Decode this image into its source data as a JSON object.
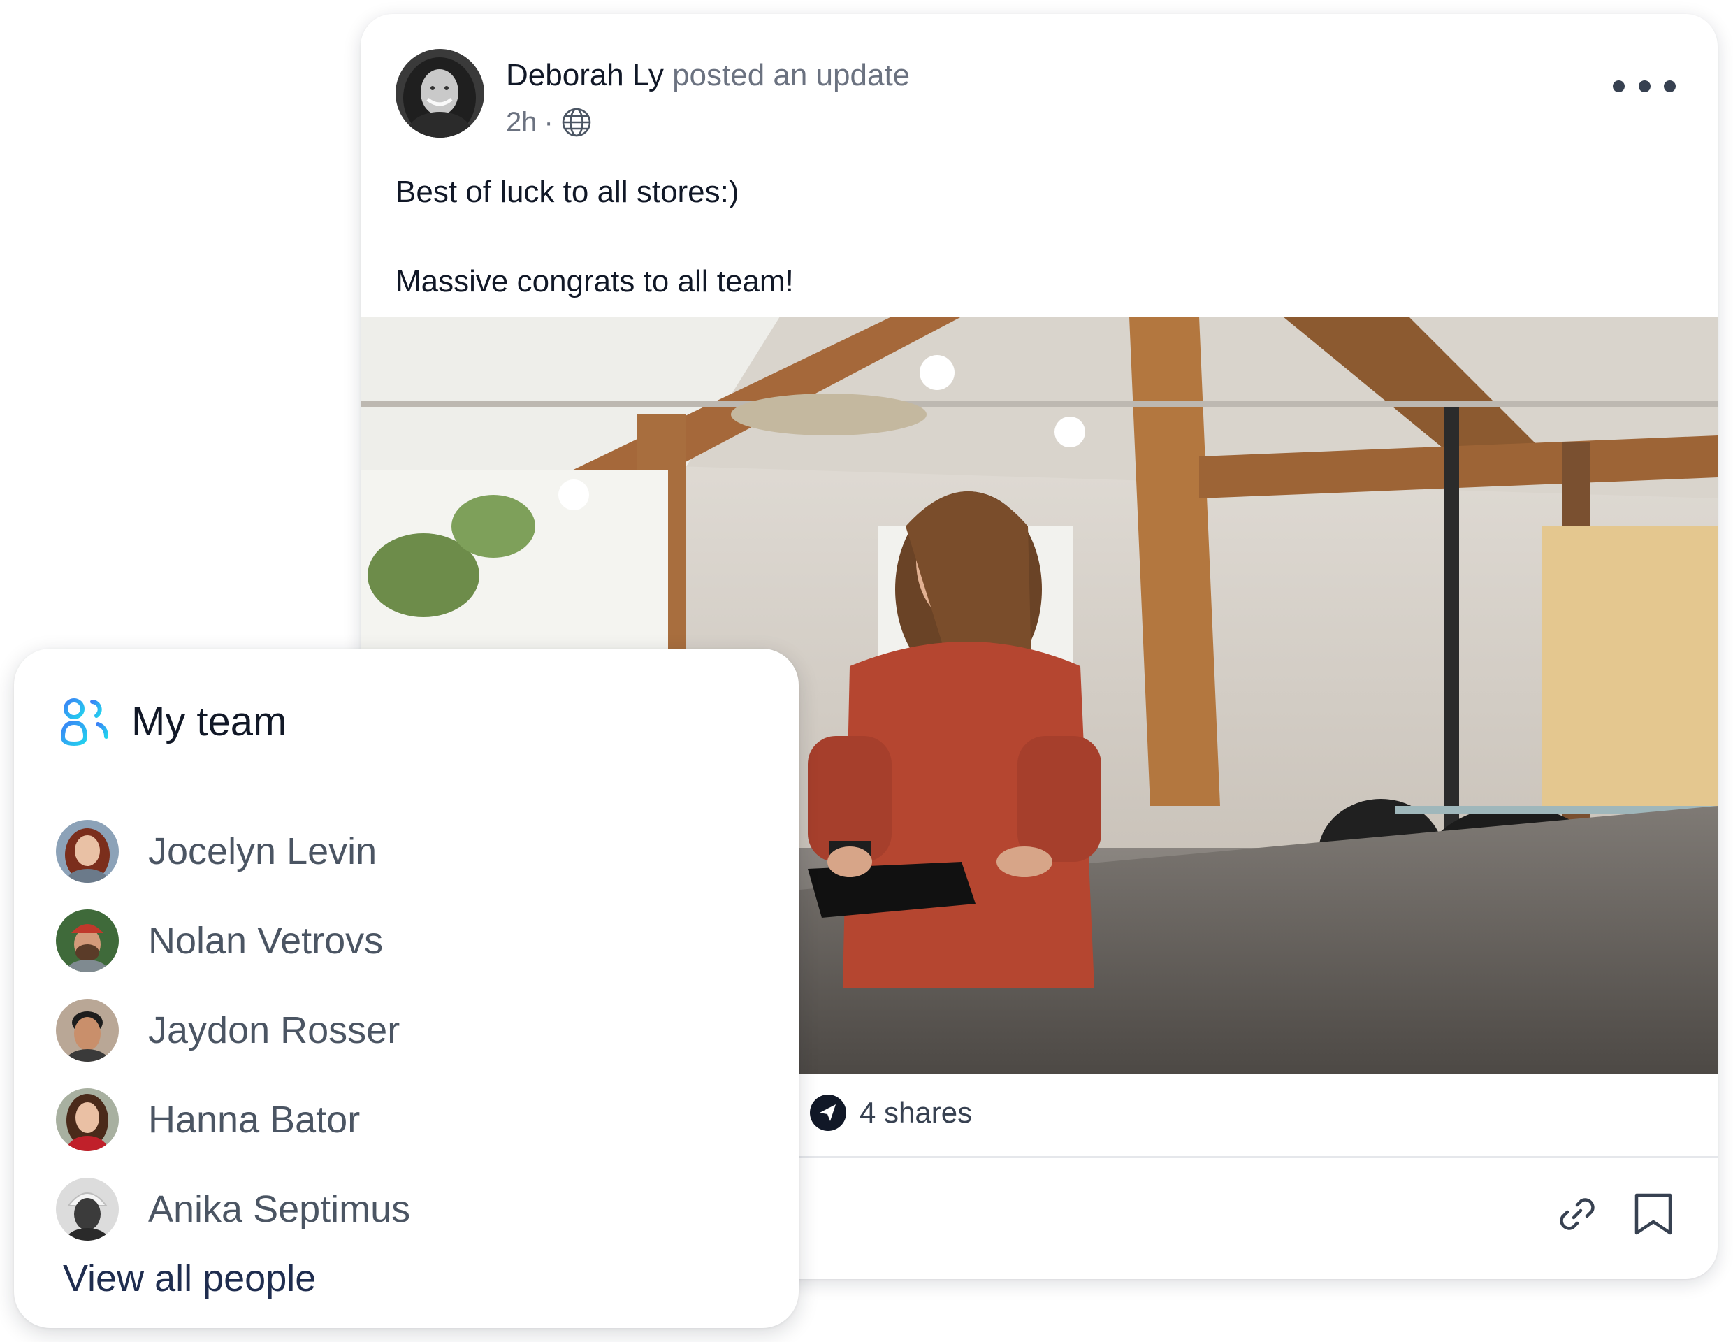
{
  "post": {
    "author_name": "Deborah Ly",
    "action_text": " posted an update",
    "time": "2h",
    "separator": "·",
    "visibility_icon": "globe-icon",
    "menu_icon": "more-horizontal-icon",
    "body_lines": [
      "Best of luck to all stores:)",
      "Massive congrats to all team!"
    ],
    "image_subject": "woman-at-checkout-photo",
    "shares_icon": "share-send-icon",
    "shares_text": "4 shares",
    "action_icons": [
      "link-icon",
      "bookmark-icon"
    ]
  },
  "team": {
    "icon": "team-icon",
    "title": "My team",
    "members": [
      {
        "name": "Jocelyn Levin"
      },
      {
        "name": "Nolan Vetrovs"
      },
      {
        "name": "Jaydon Rosser"
      },
      {
        "name": "Hanna Bator"
      },
      {
        "name": "Anika Septimus"
      }
    ],
    "view_all_label": "View all people"
  },
  "colors": {
    "text_primary": "#111827",
    "text_secondary": "#6b7280",
    "team_icon_gradient": [
      "#3b82f6",
      "#22d3ee"
    ],
    "view_all_link": "#1f2d4f"
  }
}
